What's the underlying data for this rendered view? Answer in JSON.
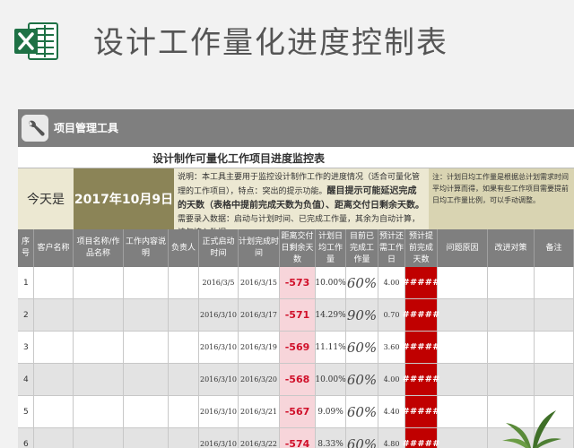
{
  "header": {
    "title": "设计工作量化进度控制表"
  },
  "toolbar": {
    "label": "项目管理工具"
  },
  "subtitle": "设计制作可量化工作项目进度监控表",
  "today": {
    "label": "今天是",
    "date": "2017年10月9日"
  },
  "desc": {
    "part1": "说明：本工具主要用于监控设计制作工作的进度情况（适合可量化管理的工作项目），特点：突出的提示功能。",
    "part2": "醒目提示可能延迟完成的天数（表格中提前完成天数为负值）、距离交付日剩余天数。",
    "part3": "需要录入数据：启动与计划时间、已完成工作量，其余为自动计算，请勿填入数据。"
  },
  "note": "注：计划日均工作量是根据总计划需求时间平均计算而得，如果有些工作项目需要提前日均工作量比例，可以手动调整。",
  "columns": [
    "序号",
    "客户名称",
    "项目名称/作品名称",
    "工作内容说明",
    "负责人",
    "正式启动时间",
    "计划完成时间",
    "距离交付日剩余天数",
    "计划日均工作量",
    "目前已完成工作量",
    "预计还需工作日",
    "预计提前完成天数",
    "问题原因",
    "改进对策",
    "备注"
  ],
  "rows": [
    {
      "no": "1",
      "start": "2016/3/5",
      "plan": "2016/3/15",
      "remain": "-573",
      "daily": "10.00%",
      "done": "60%",
      "need": "4.00",
      "early": "#####"
    },
    {
      "no": "2",
      "start": "2016/3/10",
      "plan": "2016/3/17",
      "remain": "-571",
      "daily": "14.29%",
      "done": "90%",
      "need": "0.70",
      "early": "#####"
    },
    {
      "no": "3",
      "start": "2016/3/10",
      "plan": "2016/3/19",
      "remain": "-569",
      "daily": "11.11%",
      "done": "60%",
      "need": "3.60",
      "early": "#####"
    },
    {
      "no": "4",
      "start": "2016/3/10",
      "plan": "2016/3/20",
      "remain": "-568",
      "daily": "10.00%",
      "done": "60%",
      "need": "4.00",
      "early": "#####"
    },
    {
      "no": "5",
      "start": "2016/3/10",
      "plan": "2016/3/21",
      "remain": "-567",
      "daily": "9.09%",
      "done": "60%",
      "need": "4.40",
      "early": "#####"
    },
    {
      "no": "6",
      "start": "2016/3/10",
      "plan": "2016/3/22",
      "remain": "-574",
      "daily": "8.33%",
      "done": "60%",
      "need": "4.80",
      "early": "#####"
    }
  ],
  "colors": {
    "header_gray": "#7f7f7f",
    "khaki": "#8b8457",
    "alert_red": "#c00000",
    "remain_pink": "#f7d5da",
    "excel_green": "#1e7145"
  }
}
